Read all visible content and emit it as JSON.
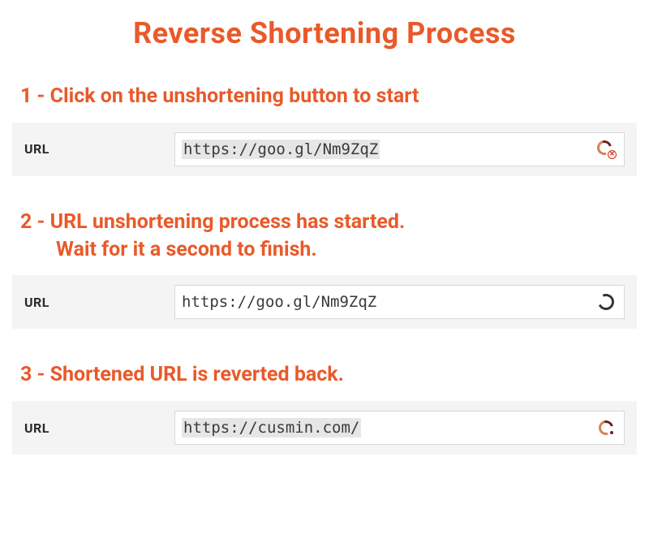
{
  "title": "Reverse Shortening Process",
  "steps": [
    {
      "heading_line1": "1 - Click on the unshortening button to start",
      "heading_line2": "",
      "url_label": "URL",
      "url_value": "https://goo.gl/Nm9ZqZ",
      "highlighted": true,
      "icon": "c-logo-x"
    },
    {
      "heading_line1": "2 - URL unshortening process has started.",
      "heading_line2": "Wait for it a second to finish.",
      "url_label": "URL",
      "url_value": "https://goo.gl/Nm9ZqZ",
      "highlighted": false,
      "icon": "spinner"
    },
    {
      "heading_line1": "3 - Shortened URL is reverted back.",
      "heading_line2": "",
      "url_label": "URL",
      "url_value": "https://cusmin.com/",
      "highlighted": true,
      "icon": "c-logo"
    }
  ]
}
